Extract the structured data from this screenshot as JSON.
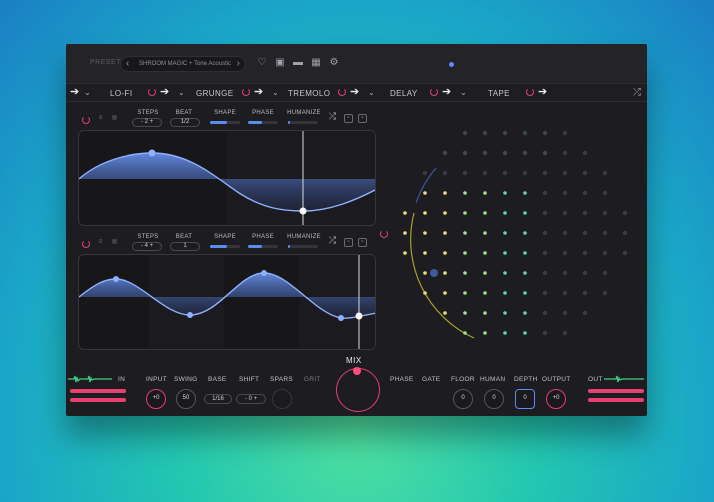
{
  "topbar": {
    "preset_label": "PRESET",
    "preset_name": "SHROOM MAGIC + Tone Acoustic",
    "icons": [
      "heart-icon",
      "save-icon",
      "folder-icon",
      "library-icon",
      "settings-icon"
    ]
  },
  "chain": {
    "effects": [
      {
        "label": "LO-FI",
        "enabled": true
      },
      {
        "label": "GRUNGE",
        "enabled": true
      },
      {
        "label": "TREMOLO",
        "enabled": true
      },
      {
        "label": "DELAY",
        "enabled": true
      },
      {
        "label": "TAPE",
        "enabled": true
      }
    ]
  },
  "lfo1": {
    "steps_label": "STEPS",
    "steps_value": "2",
    "beat_label": "BEAT",
    "beat_value": "1/2",
    "shape_label": "SHAPE",
    "shape_value": 0.55,
    "phase_label": "PHASE",
    "phase_value": 0.45,
    "humanize_label": "HUMANIZE",
    "humanize_value": 0.05
  },
  "lfo2": {
    "steps_label": "STEPS",
    "steps_value": "4",
    "beat_label": "BEAT",
    "beat_value": "1",
    "shape_label": "SHAPE",
    "shape_value": 0.55,
    "phase_label": "PHASE",
    "phase_value": 0.45,
    "humanize_label": "HUMANIZE",
    "humanize_value": 0.05
  },
  "bottom": {
    "in_label": "IN",
    "input_label": "INPUT",
    "input_value": "+0",
    "swing_label": "SWING",
    "swing_value": "50",
    "base_label": "BASE",
    "base_value": "1/16",
    "shift_label": "SHIFT",
    "shift_value": "0",
    "spars_label": "SPARS",
    "grit_label": "GRIT",
    "mix_label": "MIX",
    "phase_label": "PHASE",
    "gate_label": "GATE",
    "floor_label": "FLOOR",
    "floor_value": "0",
    "human_label": "HUMAN",
    "human_value": "0",
    "depth_label": "DEPTH",
    "depth_value": "0",
    "output_label": "OUTPUT",
    "output_value": "+0",
    "out_label": "OUT",
    "accent": "#e2406a",
    "blue": "#5b8def"
  }
}
